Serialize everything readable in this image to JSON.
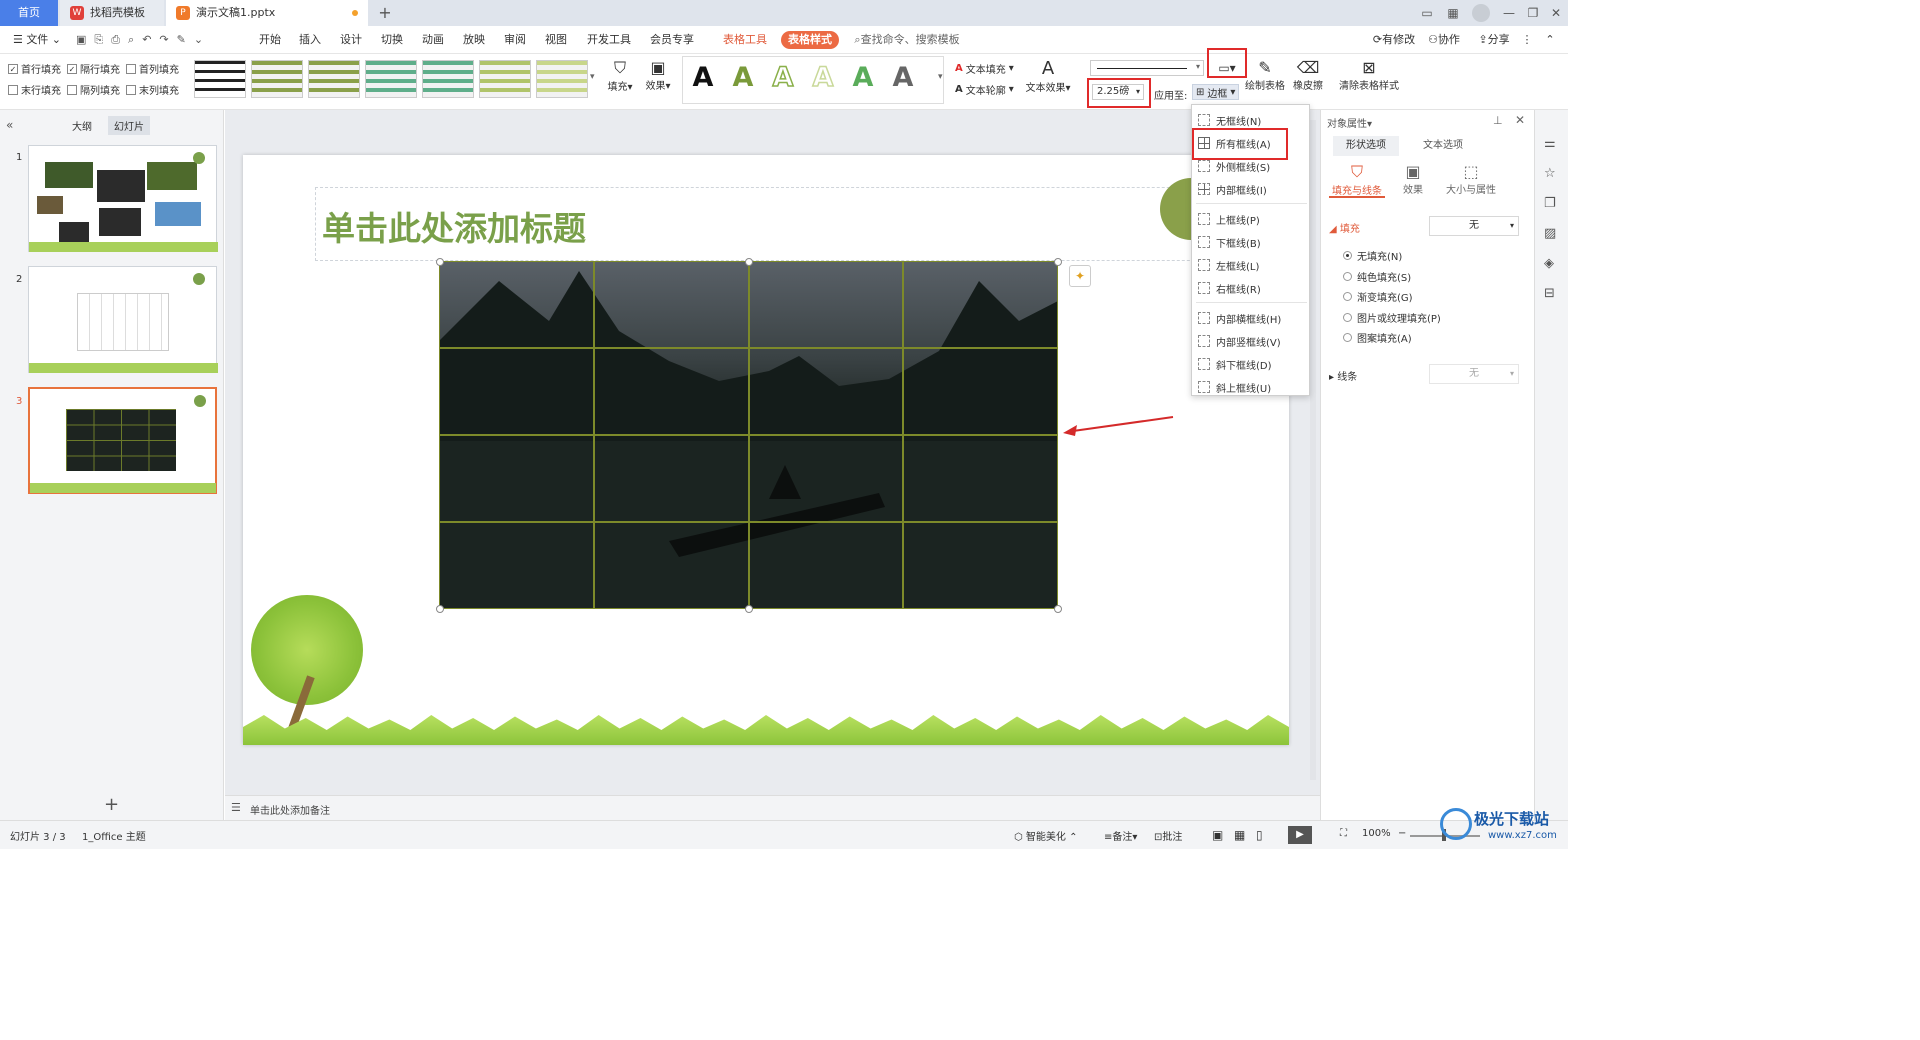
{
  "tabs": {
    "home": "首页",
    "template_tab": "找稻壳模板",
    "doc_tab": "演示文稿1.pptx"
  },
  "menu": {
    "file": "文件",
    "items": [
      "开始",
      "插入",
      "设计",
      "切换",
      "动画",
      "放映",
      "审阅",
      "视图",
      "开发工具",
      "会员专享"
    ],
    "table_tools": "表格工具",
    "table_style": "表格样式",
    "search": "查找命令、搜索模板",
    "modified": "有修改",
    "collab": "协作",
    "share": "分享"
  },
  "ribbon": {
    "checkboxes": [
      {
        "label": "首行填充",
        "checked": true
      },
      {
        "label": "隔行填充",
        "checked": true
      },
      {
        "label": "首列填充",
        "checked": false
      },
      {
        "label": "末行填充",
        "checked": false
      },
      {
        "label": "隔列填充",
        "checked": false
      },
      {
        "label": "末列填充",
        "checked": false
      }
    ],
    "fill": "填充",
    "effect": "效果",
    "text_fill": "文本填充",
    "text_outline": "文本轮廓",
    "text_effect": "文本效果",
    "pen_weight": "2.25磅",
    "apply_to": "应用至:",
    "border": "边框",
    "draw_table": "绘制表格",
    "eraser": "橡皮擦",
    "clear_style": "清除表格样式"
  },
  "style_colors": [
    "#333333",
    "#8aa04a",
    "#8aa04a",
    "#5fae8a",
    "#5fae8a",
    "#b0c46a",
    "#c8d68a"
  ],
  "wordart_colors": [
    "#111111",
    "#7a9a3a",
    "#8ab04a",
    "#c9d99a",
    "#5aac5a",
    "#666666"
  ],
  "border_menu": [
    {
      "label": "无框线(N)",
      "icon": "no-border-icon"
    },
    {
      "label": "所有框线(A)",
      "icon": "all-borders-icon"
    },
    {
      "label": "外侧框线(S)",
      "icon": "outside-borders-icon"
    },
    {
      "label": "内部框线(I)",
      "icon": "inside-borders-icon"
    },
    {
      "label": "上框线(P)",
      "icon": "top-border-icon"
    },
    {
      "label": "下框线(B)",
      "icon": "bottom-border-icon"
    },
    {
      "label": "左框线(L)",
      "icon": "left-border-icon"
    },
    {
      "label": "右框线(R)",
      "icon": "right-border-icon"
    },
    {
      "label": "内部横框线(H)",
      "icon": "inside-horizontal-icon"
    },
    {
      "label": "内部竖框线(V)",
      "icon": "inside-vertical-icon"
    },
    {
      "label": "斜下框线(D)",
      "icon": "diagonal-down-icon"
    },
    {
      "label": "斜上框线(U)",
      "icon": "diagonal-up-icon"
    }
  ],
  "left_pane": {
    "outline_tab": "大纲",
    "slides_tab": "幻灯片",
    "slide_numbers": [
      "1",
      "2",
      "3"
    ]
  },
  "slide": {
    "title_placeholder": "单击此处添加标题",
    "table_rows": 4,
    "table_cols": 4,
    "grid_color": "#7d8a2a",
    "title_color": "#7aa04a"
  },
  "notes_placeholder": "单击此处添加备注",
  "right_panel": {
    "header": "对象属性",
    "tab_shape": "形状选项",
    "tab_text": "文本选项",
    "sub_fill_line": "填充与线条",
    "sub_effect": "效果",
    "sub_size": "大小与属性",
    "fill_label": "填充",
    "fill_value": "无",
    "fill_options": [
      {
        "label": "无填充(N)",
        "selected": true
      },
      {
        "label": "纯色填充(S)",
        "selected": false
      },
      {
        "label": "渐变填充(G)",
        "selected": false
      },
      {
        "label": "图片或纹理填充(P)",
        "selected": false
      },
      {
        "label": "图案填充(A)",
        "selected": false
      }
    ],
    "line_label": "线条",
    "line_value": "无"
  },
  "status": {
    "slide_info": "幻灯片 3 / 3",
    "theme": "1_Office 主题",
    "smart_beautify": "智能美化",
    "notes": "备注",
    "comments": "批注",
    "zoom": "100%"
  },
  "watermark": {
    "name": "极光下载站",
    "url": "www.xz7.com"
  }
}
